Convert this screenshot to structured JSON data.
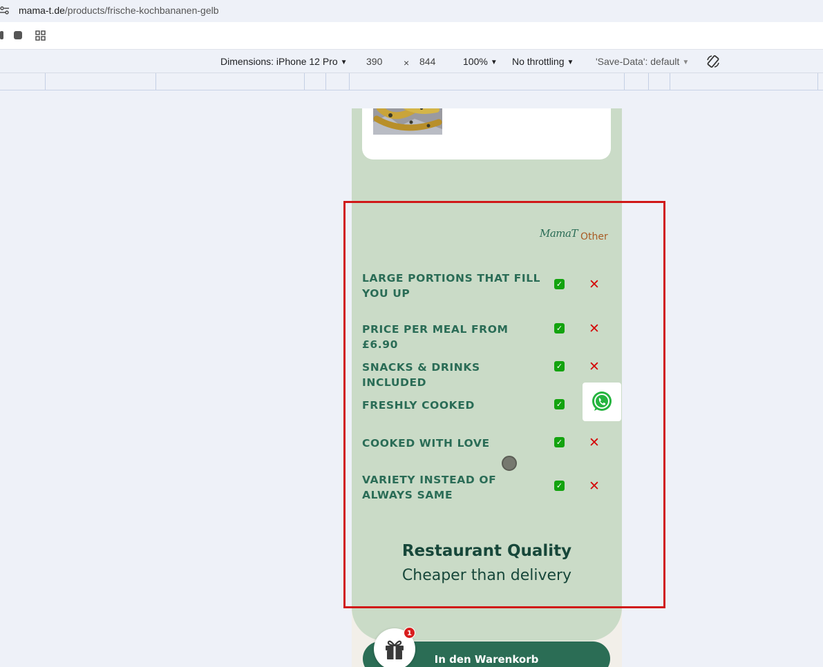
{
  "browser": {
    "url_host": "mama-t.de",
    "url_path": "/products/frische-kochbananen-gelb"
  },
  "device_toolbar": {
    "device": "Dimensions: iPhone 12 Pro",
    "width": "390",
    "times": "×",
    "height": "844",
    "zoom": "100%",
    "throttling": "No throttling",
    "save_data": "'Save-Data': default"
  },
  "comparison": {
    "brand": "MamaT",
    "other_label": "Other",
    "check_glyph": "✓",
    "cross_glyph": "✕",
    "features": [
      {
        "label": "LARGE PORTIONS THAT FILL YOU UP",
        "mama_t": true,
        "other": false
      },
      {
        "label": "PRICE PER MEAL FROM £6.90",
        "mama_t": true,
        "other": false
      },
      {
        "label": "SNACKS & DRINKS INCLUDED",
        "mama_t": true,
        "other": false
      },
      {
        "label": "FRESHLY COOKED",
        "mama_t": true,
        "other": false
      },
      {
        "label": "COOKED WITH LOVE",
        "mama_t": true,
        "other": false
      },
      {
        "label": "VARIETY INSTEAD OF ALWAYS SAME",
        "mama_t": true,
        "other": false
      }
    ],
    "quality_title": "Restaurant Quality",
    "quality_subtitle": "Cheaper than delivery"
  },
  "cart": {
    "button_label": "In den Warenkorb",
    "gift_badge_count": "1"
  },
  "colors": {
    "panel_green": "#cadbc7",
    "text_green": "#2a6c56",
    "other_orange": "#a85a23",
    "check_green": "#13a30f",
    "cross_red": "#d40a0a",
    "cart_button": "#2b6d55",
    "highlight_red": "#d01818"
  }
}
